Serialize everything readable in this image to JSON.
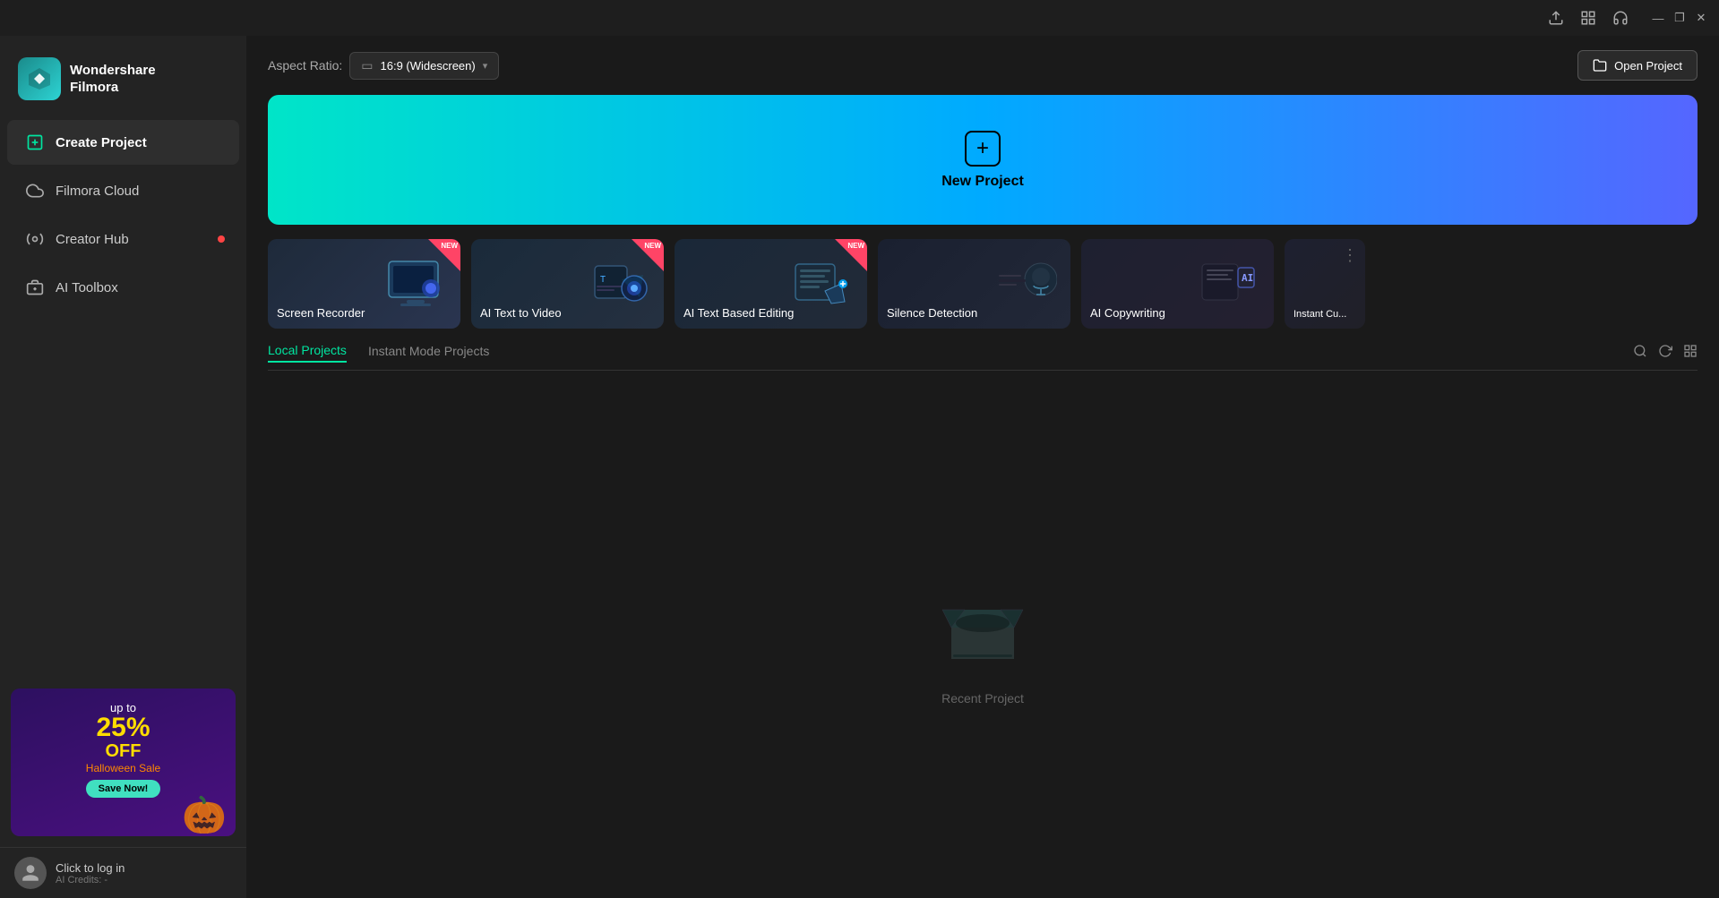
{
  "titlebar": {
    "icons": [
      "upload-icon",
      "grid-icon",
      "headset-icon"
    ],
    "controls": {
      "minimize": "—",
      "maximize": "❐",
      "close": "✕"
    }
  },
  "sidebar": {
    "brand": {
      "line1": "Wondershare",
      "line2": "Filmora"
    },
    "nav": [
      {
        "id": "create-project",
        "label": "Create Project",
        "active": true,
        "dot": false
      },
      {
        "id": "filmora-cloud",
        "label": "Filmora Cloud",
        "active": false,
        "dot": false
      },
      {
        "id": "creator-hub",
        "label": "Creator Hub",
        "active": false,
        "dot": true
      },
      {
        "id": "ai-toolbox",
        "label": "AI Toolbox",
        "active": false,
        "dot": false
      }
    ],
    "ad": {
      "upto": "up to",
      "percent": "25%",
      "off": "OFF",
      "sale": "Halloween Sale",
      "btn": "Save Now!"
    },
    "user": {
      "name": "Click to log in",
      "credits": "AI Credits: -"
    }
  },
  "topbar": {
    "aspect_label": "Aspect Ratio:",
    "aspect_value": "16:9 (Widescreen)",
    "open_project": "Open Project"
  },
  "hero": {
    "label": "New Project"
  },
  "feature_cards": [
    {
      "id": "screen-recorder",
      "label": "Screen Recorder",
      "badge": "NEW"
    },
    {
      "id": "ai-text-to-video",
      "label": "AI Text to Video",
      "badge": "NEW"
    },
    {
      "id": "ai-text-based-editing",
      "label": "AI Text Based Editing",
      "badge": "NEW"
    },
    {
      "id": "silence-detection",
      "label": "Silence Detection",
      "badge": null
    },
    {
      "id": "ai-copywriting",
      "label": "AI Copywriting",
      "badge": null
    },
    {
      "id": "instant-cut",
      "label": "Instant Cut",
      "badge": null
    }
  ],
  "projects": {
    "tabs": [
      {
        "id": "local-projects",
        "label": "Local Projects",
        "active": true
      },
      {
        "id": "instant-mode",
        "label": "Instant Mode Projects",
        "active": false
      }
    ],
    "empty_label": "Recent Project"
  }
}
